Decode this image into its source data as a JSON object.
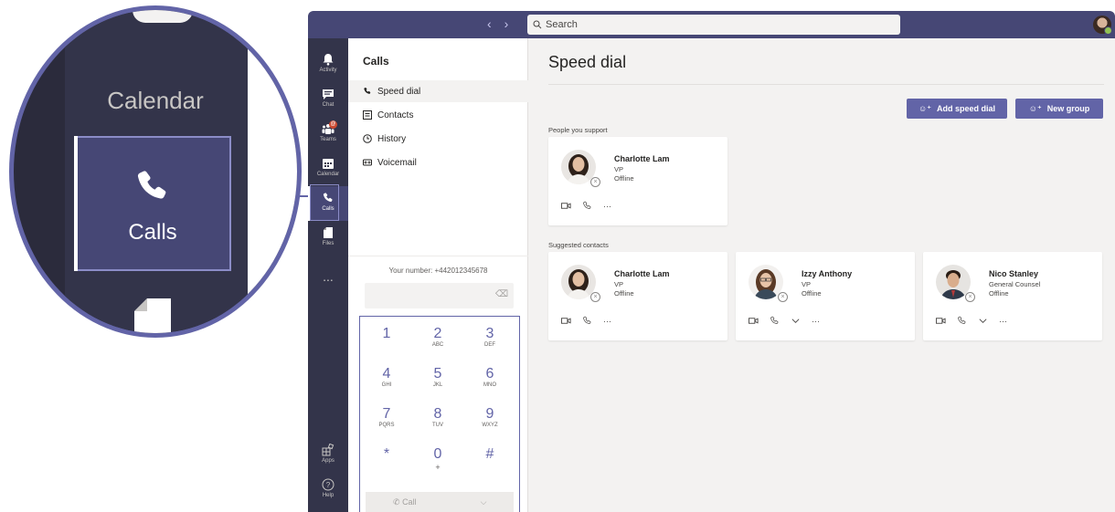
{
  "zoom": {
    "calendar_label": "Calendar",
    "calls_label": "Calls"
  },
  "titlebar": {
    "back_icon": "chevron-left-icon",
    "forward_icon": "chevron-right-icon",
    "search_placeholder": "Search"
  },
  "rail": {
    "items": [
      {
        "label": "Activity",
        "icon": "bell-icon"
      },
      {
        "label": "Chat",
        "icon": "chat-icon"
      },
      {
        "label": "Teams",
        "icon": "teams-icon",
        "badge": "@"
      },
      {
        "label": "Calendar",
        "icon": "calendar-icon"
      },
      {
        "label": "Calls",
        "icon": "phone-icon"
      },
      {
        "label": "Files",
        "icon": "file-icon"
      }
    ],
    "more": "...",
    "apps_label": "Apps",
    "help_label": "Help"
  },
  "panel": {
    "title": "Calls",
    "items": [
      {
        "label": "Speed dial",
        "icon": "phone-icon"
      },
      {
        "label": "Contacts",
        "icon": "contacts-icon"
      },
      {
        "label": "History",
        "icon": "history-icon"
      },
      {
        "label": "Voicemail",
        "icon": "voicemail-icon"
      }
    ],
    "your_number": "Your number: +442012345678",
    "dialpad": [
      {
        "digit": "1",
        "letters": ""
      },
      {
        "digit": "2",
        "letters": "ABC"
      },
      {
        "digit": "3",
        "letters": "DEF"
      },
      {
        "digit": "4",
        "letters": "GHI"
      },
      {
        "digit": "5",
        "letters": "JKL"
      },
      {
        "digit": "6",
        "letters": "MNO"
      },
      {
        "digit": "7",
        "letters": "PQRS"
      },
      {
        "digit": "8",
        "letters": "TUV"
      },
      {
        "digit": "9",
        "letters": "WXYZ"
      },
      {
        "digit": "*",
        "letters": ""
      },
      {
        "digit": "0",
        "letters": "+"
      },
      {
        "digit": "#",
        "letters": ""
      }
    ],
    "call_label": "Call"
  },
  "main": {
    "title": "Speed dial",
    "add_speed_dial": "Add speed dial",
    "new_group": "New group",
    "section_support": "People you support",
    "section_suggested": "Suggested contacts",
    "support_cards": [
      {
        "name": "Charlotte Lam",
        "title": "VP",
        "status": "Offline"
      }
    ],
    "suggested_cards": [
      {
        "name": "Charlotte Lam",
        "title": "VP",
        "status": "Offline"
      },
      {
        "name": "Izzy Anthony",
        "title": "VP",
        "status": "Offline"
      },
      {
        "name": "Nico Stanley",
        "title": "General Counsel",
        "status": "Offline"
      }
    ],
    "more": "···"
  },
  "colors": {
    "brand": "#6264a7",
    "titlebar": "#464775",
    "rail": "#33344a"
  }
}
